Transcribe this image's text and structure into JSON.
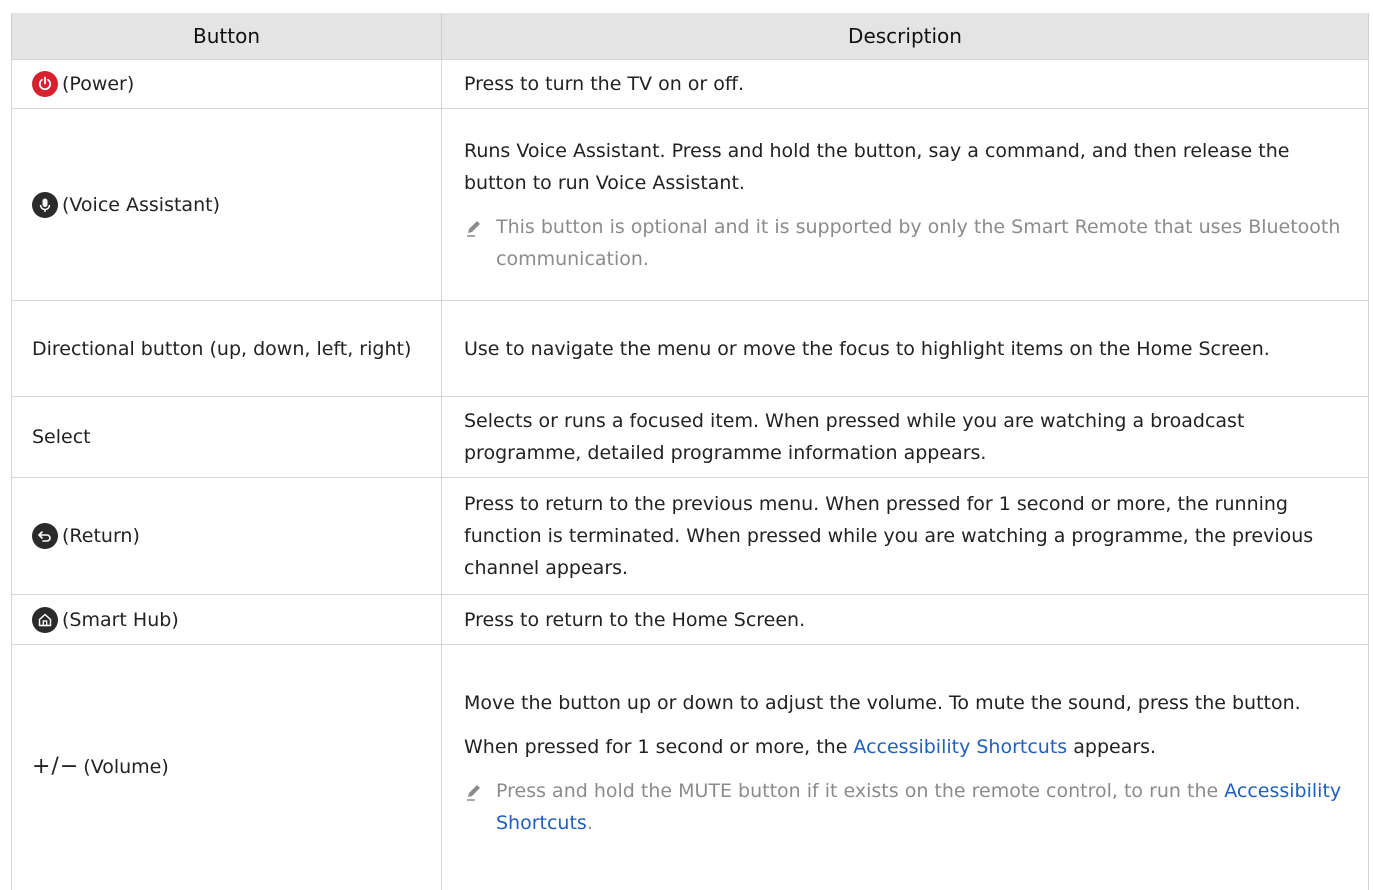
{
  "header": {
    "button": "Button",
    "description": "Description"
  },
  "rows": [
    {
      "icon": "power-icon",
      "label": "(Power)",
      "description": "Press to turn the TV on or off."
    },
    {
      "icon": "microphone-icon",
      "label": "(Voice Assistant)",
      "description": "Runs Voice Assistant. Press and hold the button, say a command, and then release the button to run Voice Assistant.",
      "note": "This button is optional and it is supported by only the Smart Remote that uses Bluetooth communication."
    },
    {
      "label": "Directional button (up, down, left, right)",
      "description": "Use to navigate the menu or move the focus to highlight items on the Home Screen."
    },
    {
      "label": "Select",
      "description": "Selects or runs a focused item. When pressed while you are watching a broadcast programme, detailed programme information appears."
    },
    {
      "icon": "return-icon",
      "label": "(Return)",
      "description": "Press to return to the previous menu. When pressed for 1 second or more, the running function is terminated. When pressed while you are watching a programme, the previous channel appears."
    },
    {
      "icon": "home-icon",
      "label": "(Smart Hub)",
      "description": "Press to return to the Home Screen."
    },
    {
      "icon_text": "+/−",
      "label": "(Volume)",
      "description": "Move the button up or down to adjust the volume. To mute the sound, press the button.",
      "desc2_before": "When pressed for 1 second or more, the ",
      "desc2_link": "Accessibility Shortcuts",
      "desc2_after": " appears.",
      "note_before": "Press and hold the MUTE button if it exists on the remote control, to run the ",
      "note_link": "Accessibility Shortcuts",
      "note_after": "."
    }
  ],
  "colors": {
    "link": "#1f5fbf",
    "note": "#8b8b8b",
    "header_bg": "#e4e4e4",
    "power": "#d8202f"
  }
}
